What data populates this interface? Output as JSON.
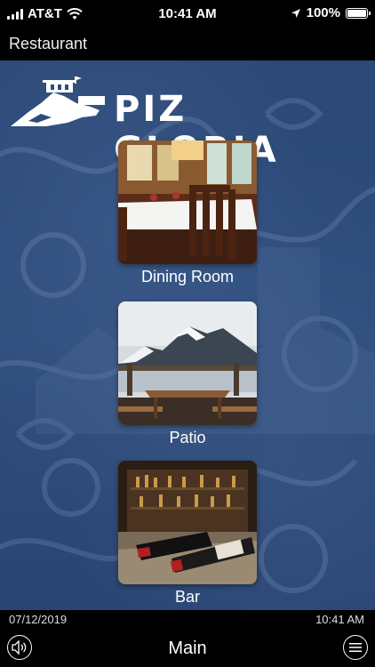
{
  "status_bar": {
    "carrier": "AT&T",
    "time": "10:41 AM",
    "battery": "100%"
  },
  "nav": {
    "title": "Restaurant"
  },
  "logo": {
    "text": "PIZ GLORIA"
  },
  "cards": [
    {
      "label": "Dining Room"
    },
    {
      "label": "Patio"
    },
    {
      "label": "Bar"
    }
  ],
  "footer": {
    "date": "07/12/2019",
    "time": "10:41 AM",
    "title": "Main"
  },
  "colors": {
    "background": "#2e4d7c",
    "bar": "#000000",
    "text": "#ffffff"
  },
  "icons": {
    "left": "speaker-icon",
    "right": "menu-icon"
  }
}
